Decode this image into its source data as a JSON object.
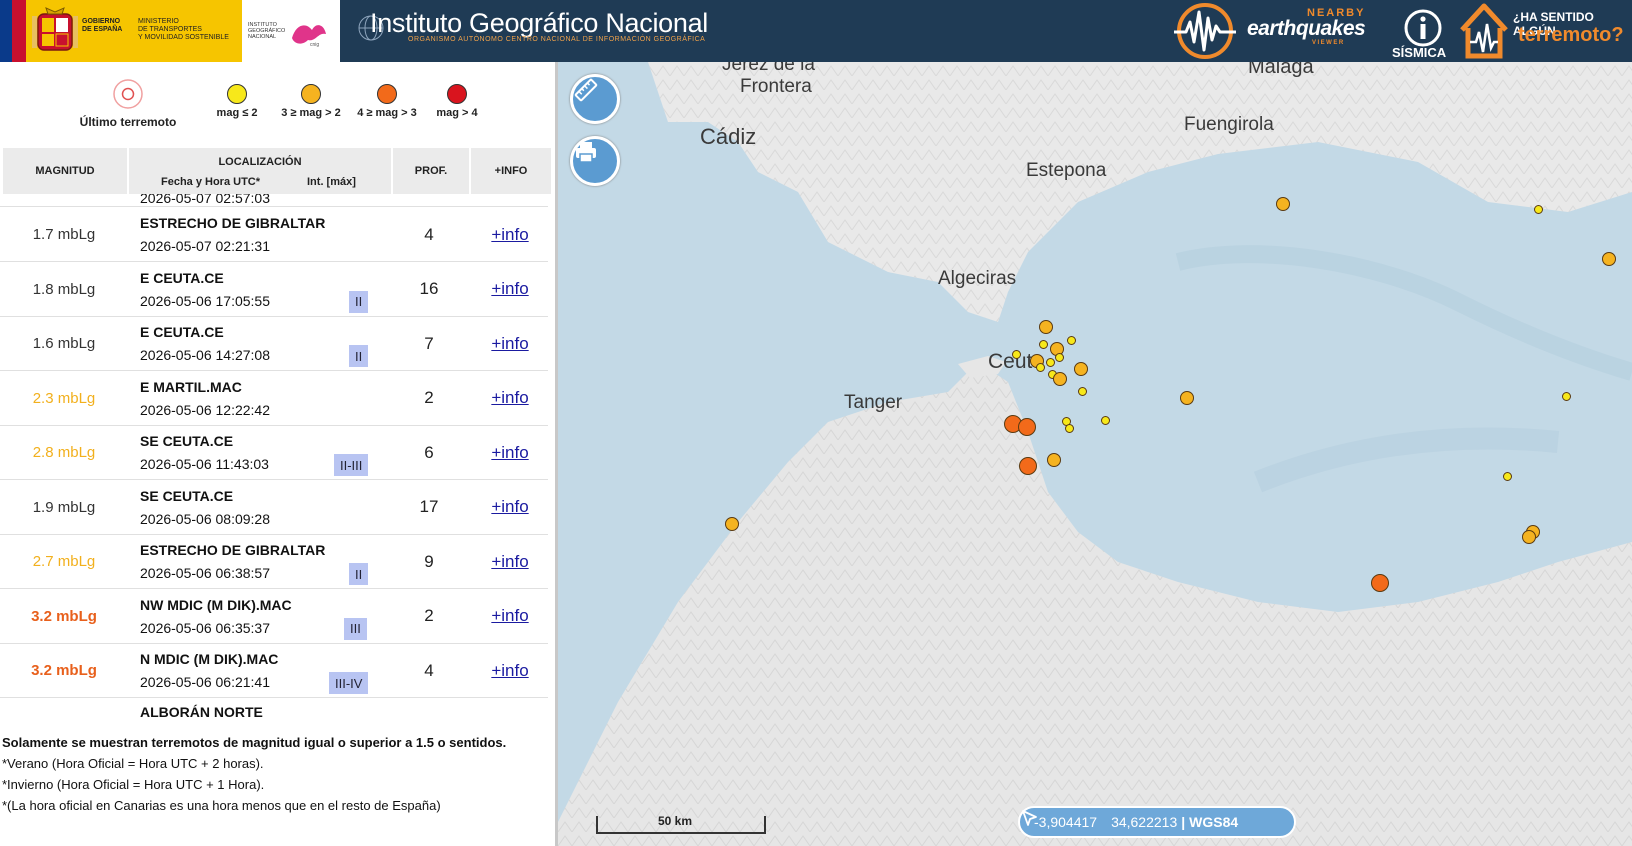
{
  "header": {
    "gov_line1": "GOBIERNO",
    "gov_line2": "DE ESPAÑA",
    "ministry_line1": "MINISTERIO",
    "ministry_line2": "DE TRANSPORTES",
    "ministry_line3": "Y MOVILIDAD SOSTENIBLE",
    "ign_small_1": "INSTITUTO",
    "ign_small_2": "GEOGRÁFICO",
    "ign_small_3": "NACIONAL",
    "ign_title": "Instituto Geográfico Nacional",
    "ign_subtitle": "ORGANISMO AUTÓNOMO CENTRO NACIONAL DE INFORMACIÓN GEOGRÁFICA",
    "ne_nearby": "NEARBY",
    "ne_earthquakes": "earthquakes",
    "ne_viewer": "VIEWER",
    "sismica": "SÍSMICA",
    "has_sentido": "¿HA SENTIDO ALGÚN",
    "terremoto": "terremoto?"
  },
  "legend": {
    "ultimo": "Último terremoto",
    "mag1": "mag ≤ 2",
    "mag2": "3 ≥ mag > 2",
    "mag3": "4 ≥ mag > 3",
    "mag4": "mag > 4",
    "colors": {
      "ultimo": "#e05050",
      "m1": "#f7e81a",
      "m2": "#f5b320",
      "m3": "#f26a1a",
      "m4": "#d9141e"
    }
  },
  "table": {
    "col_mag": "MAGNITUD",
    "col_loc": "LOCALIZACIÓN",
    "col_date": "Fecha y Hora UTC*",
    "col_int": "Int. [máx]",
    "col_prof": "PROF.",
    "col_info": "+INFO",
    "partial_top_date": "2026-05-07 02:57:03",
    "partial_bottom_loc": "ALBORÁN NORTE",
    "rows": [
      {
        "mag": "1.7 mbLg",
        "loc": "ESTRECHO DE GIBRALTAR",
        "date": "2026-05-07 02:21:31",
        "int": "",
        "prof": "4",
        "info": "+info"
      },
      {
        "mag": "1.8 mbLg",
        "loc": "E CEUTA.CE",
        "date": "2026-05-06 17:05:55",
        "int": "II",
        "prof": "16",
        "info": "+info"
      },
      {
        "mag": "1.6 mbLg",
        "loc": "E CEUTA.CE",
        "date": "2026-05-06 14:27:08",
        "int": "II",
        "prof": "7",
        "info": "+info"
      },
      {
        "mag": "2.3 mbLg",
        "loc": "E MARTIL.MAC",
        "date": "2026-05-06 12:22:42",
        "int": "",
        "prof": "2",
        "info": "+info"
      },
      {
        "mag": "2.8 mbLg",
        "loc": "SE CEUTA.CE",
        "date": "2026-05-06 11:43:03",
        "int": "II-III",
        "prof": "6",
        "info": "+info"
      },
      {
        "mag": "1.9 mbLg",
        "loc": "SE CEUTA.CE",
        "date": "2026-05-06 08:09:28",
        "int": "",
        "prof": "17",
        "info": "+info"
      },
      {
        "mag": "2.7 mbLg",
        "loc": "ESTRECHO DE GIBRALTAR",
        "date": "2026-05-06 06:38:57",
        "int": "II",
        "prof": "9",
        "info": "+info"
      },
      {
        "mag": "3.2 mbLg",
        "loc": "NW MDIC (M DIK).MAC",
        "date": "2026-05-06 06:35:37",
        "int": "III",
        "prof": "2",
        "info": "+info"
      },
      {
        "mag": "3.2 mbLg",
        "loc": "N MDIC (M DIK).MAC",
        "date": "2026-05-06 06:21:41",
        "int": "III-IV",
        "prof": "4",
        "info": "+info"
      }
    ],
    "mag_colors": {
      "low": "#333333",
      "mid": "#f2b01d",
      "high": "#e8601c"
    }
  },
  "notes": {
    "n1": "Solamente se muestran terremotos de magnitud igual o superior a 1.5 o sentidos.",
    "n2": "*Verano (Hora Oficial = Hora UTC + 2 horas).",
    "n3": "*Invierno (Hora Oficial = Hora UTC + 1 Hora).",
    "n4": "*(La hora oficial en Canarias es una hora menos que en el resto de España)"
  },
  "map": {
    "places": {
      "jerez1": "Jerez de la",
      "jerez2": "Frontera",
      "malaga": "Málaga",
      "cadiz": "Cádiz",
      "fuengirola": "Fuengirola",
      "estepona": "Estepona",
      "algeciras": "Algeciras",
      "ceuta": "Ceuta",
      "tanger": "Tanger"
    },
    "scale_label": "50 km",
    "coords_lon": "-3,904417",
    "coords_lat": "34,622213",
    "coords_sep": "|",
    "coords_crs": "WGS84",
    "measure_icon": "ruler-icon",
    "print_icon": "printer-icon"
  }
}
